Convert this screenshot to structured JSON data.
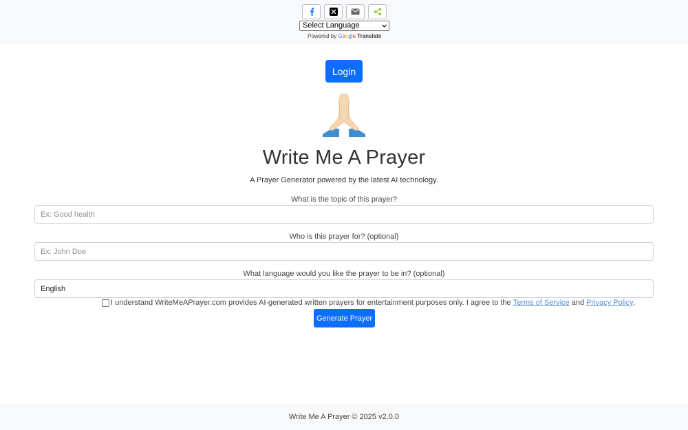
{
  "share": {
    "buttons": [
      {
        "icon": "facebook-icon",
        "color": "#1877f2"
      },
      {
        "icon": "x-icon",
        "color": "#000000"
      },
      {
        "icon": "email-icon",
        "color": "#666666"
      },
      {
        "icon": "share-icon",
        "color": "#8dc63f"
      }
    ]
  },
  "translate": {
    "select_label": "Select Language",
    "powered_by": "Powered by",
    "google": "Google",
    "translate_word": "Translate"
  },
  "header": {
    "login_label": "Login"
  },
  "main": {
    "icon": "praying-hands-icon",
    "title": "Write Me A Prayer",
    "subtitle": "A Prayer Generator powered by the latest AI technology.",
    "topic": {
      "label": "What is the topic of this prayer?",
      "placeholder": "Ex: Good health",
      "value": ""
    },
    "recipient": {
      "label": "Who is this prayer for? (optional)",
      "placeholder": "Ex: John Doe",
      "value": ""
    },
    "language": {
      "label": "What language would you like the prayer to be in? (optional)",
      "value": "English"
    },
    "agreement": {
      "text": "I understand WriteMeAPrayer.com provides AI-generated written prayers for entertainment purposes only. I agree to the",
      "terms_link": "Terms of Service",
      "and": "and",
      "privacy_link": "Privacy Policy",
      "end": ".",
      "checked": false
    },
    "generate_label": "Generate Prayer"
  },
  "footer": {
    "text": "Write Me A Prayer © 2025 v2.0.0"
  },
  "colors": {
    "primary": "#0d6efd",
    "topbar_bg": "#f8f9fa",
    "link": "#5b8dd6"
  }
}
